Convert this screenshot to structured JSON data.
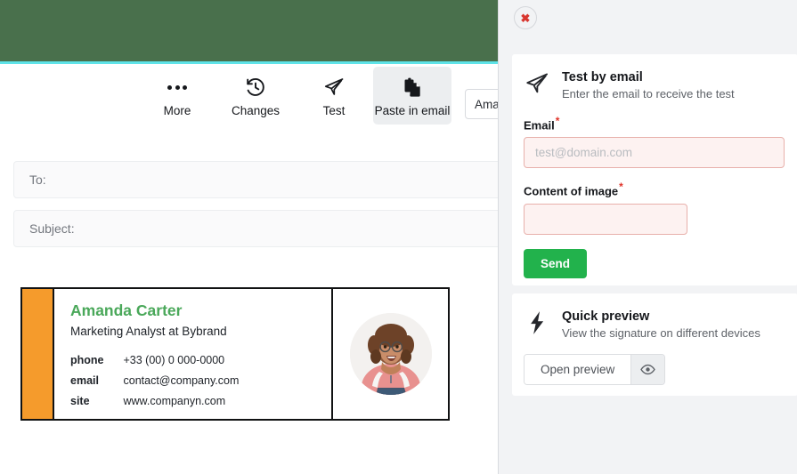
{
  "toolbar": {
    "items": [
      {
        "label": "More",
        "icon": "more-dots-icon",
        "active": false
      },
      {
        "label": "Changes",
        "icon": "history-clock-icon",
        "active": false
      },
      {
        "label": "Test",
        "icon": "paper-plane-icon",
        "active": false
      },
      {
        "label": "Paste in email",
        "icon": "clipboard-copy-icon",
        "active": true
      }
    ],
    "name_input_value": "Amanda Carter"
  },
  "compose": {
    "to_label": "To:",
    "subject_label": "Subject:"
  },
  "signature": {
    "name": "Amanda Carter",
    "title": "Marketing Analyst at Bybrand",
    "rows": [
      {
        "key": "phone",
        "value": "+33 (00) 0 000-0000"
      },
      {
        "key": "email",
        "value": "contact@company.com"
      },
      {
        "key": "site",
        "value": "www.companyn.com"
      }
    ],
    "accent_color": "#f59b2c",
    "name_color": "#4aa85a"
  },
  "panel": {
    "close_label": "✖",
    "test_card": {
      "title": "Test by email",
      "subtitle": "Enter the email to receive the test",
      "icon": "paper-plane-icon",
      "email_label": "Email",
      "email_required_mark": "*",
      "email_placeholder": "test@domain.com",
      "email_value": "",
      "content_label": "Content of image",
      "content_required_mark": "*",
      "content_value": "",
      "send_label": "Send",
      "send_color": "#22b24c"
    },
    "preview_card": {
      "title": "Quick preview",
      "subtitle": "View the signature on different devices",
      "icon": "lightning-bolt-icon",
      "open_label": "Open preview",
      "eye_icon": "eye-icon"
    }
  },
  "theme": {
    "header_green": "#49704c",
    "header_accent": "#5fe3e8",
    "panel_bg": "#f2f3f5"
  }
}
